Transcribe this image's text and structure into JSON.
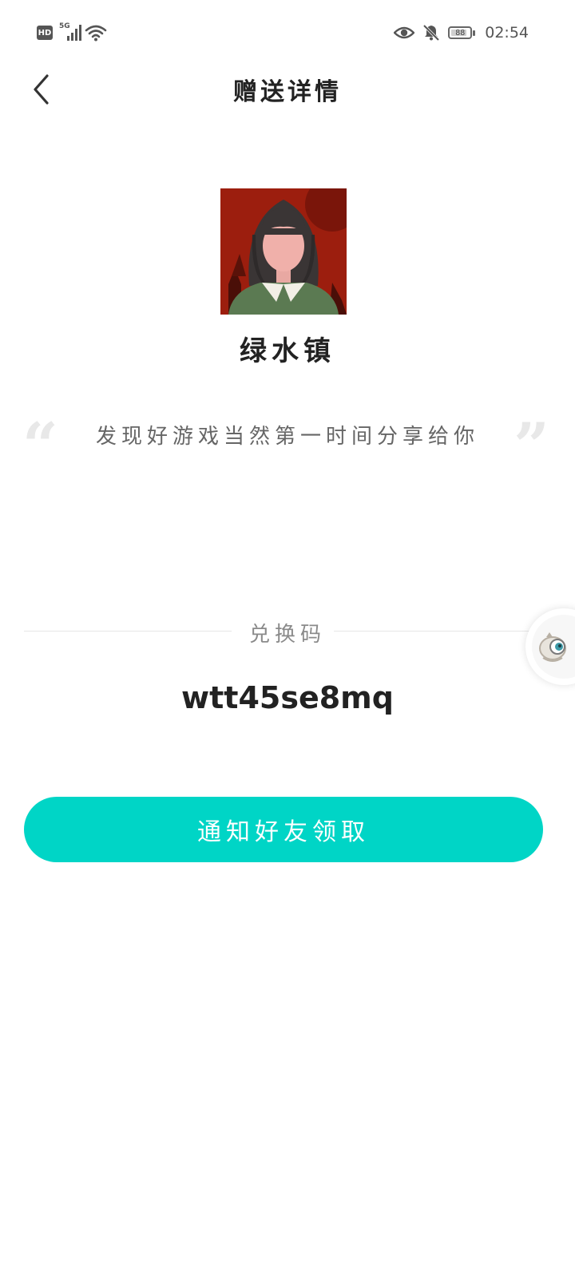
{
  "status_bar": {
    "hd_label": "HD",
    "network_label": "5G",
    "battery_level_text": "88",
    "battery_percent": 88,
    "time": "02:54",
    "icons": [
      "signal-icon",
      "wifi-icon",
      "eye-icon",
      "bell-muted-icon",
      "battery-icon"
    ]
  },
  "header": {
    "title": "赠送详情",
    "back_icon": "chevron-left-icon"
  },
  "game": {
    "name": "绿水镇",
    "cover_icon": "game-cover-illustration"
  },
  "share": {
    "message": "发现好游戏当然第一时间分享给你"
  },
  "redeem": {
    "label": "兑换码",
    "code": "wtt45se8mq"
  },
  "actions": {
    "notify_button_label": "通知好友领取"
  },
  "colors": {
    "accent": "#00d5c6",
    "title_text": "#222222",
    "secondary_text": "#666666",
    "divider": "#e6e6e6",
    "quote_mark": "#e8e8e8"
  }
}
